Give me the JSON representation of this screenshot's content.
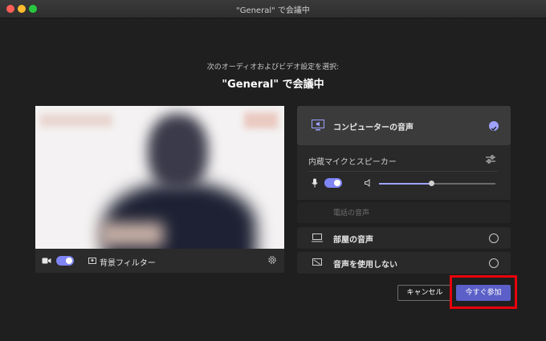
{
  "window": {
    "title": "\"General\" で会議中"
  },
  "header": {
    "subtitle": "次のオーディオおよびビデオ設定を選択:",
    "title": "\"General\" で会議中"
  },
  "preview_bar": {
    "camera_on": true,
    "background_filter_label": "背景フィルター"
  },
  "audio": {
    "computer_audio_label": "コンピューターの音声",
    "device_label": "内蔵マイクとスピーカー",
    "mic_on": true,
    "volume": 0.45,
    "phone_audio_label": "電話の音声",
    "room_audio_label": "部屋の音声",
    "no_audio_label": "音声を使用しない"
  },
  "actions": {
    "cancel_label": "キャンセル",
    "join_label": "今すぐ参加"
  },
  "colors": {
    "accent": "#5b5fc7",
    "toggle": "#7f85f5",
    "highlight": "#e8000b"
  }
}
